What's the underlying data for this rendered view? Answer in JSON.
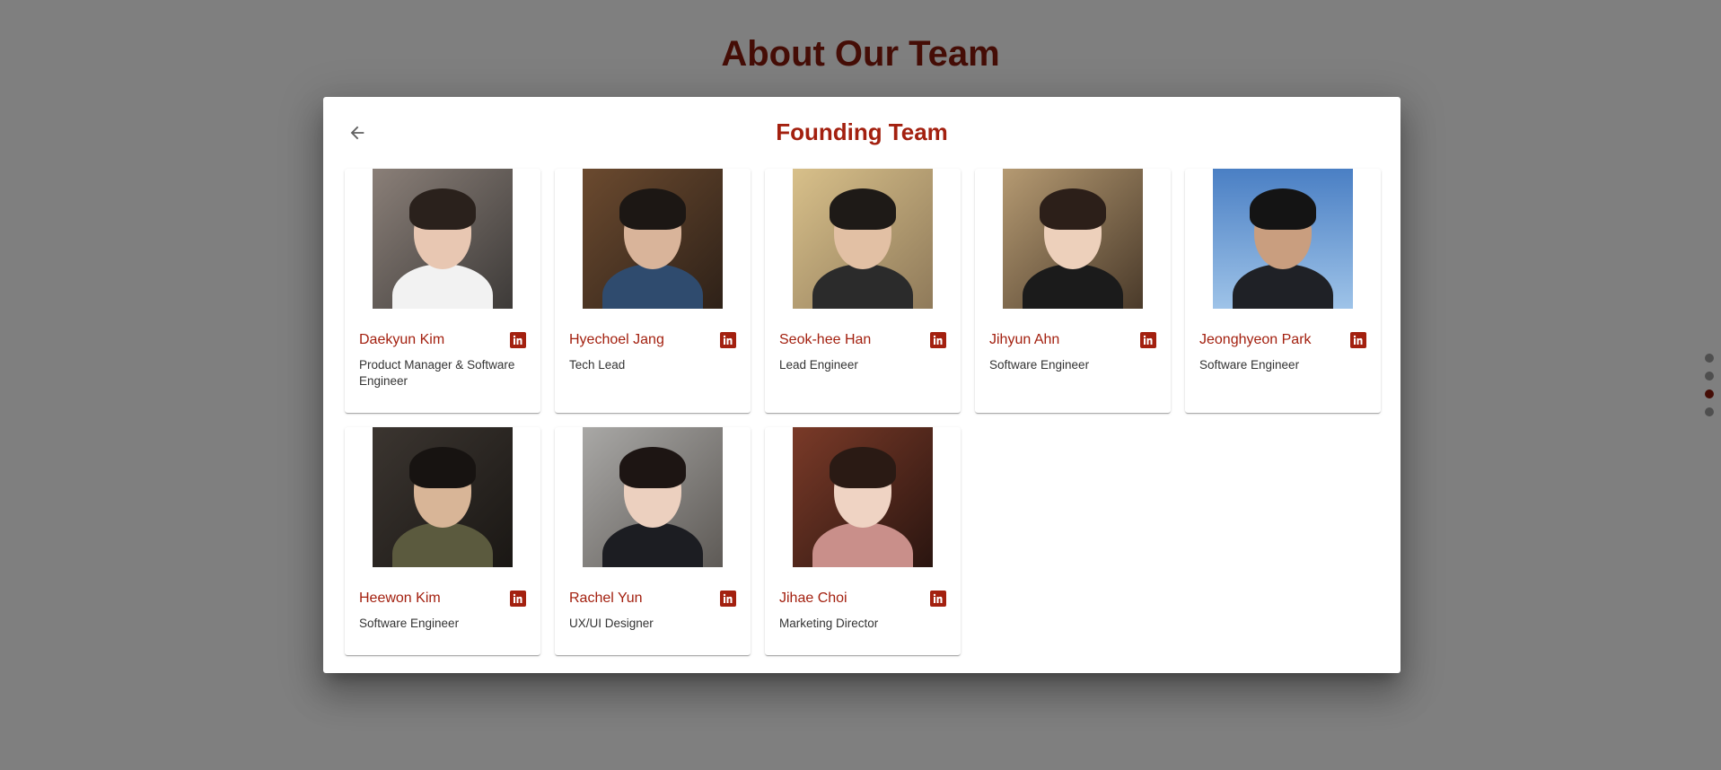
{
  "page": {
    "heading": "About Our Team"
  },
  "dialog": {
    "title": "Founding Team",
    "back_icon": "arrow-left-icon"
  },
  "colors": {
    "accent": "#a3200f",
    "heading": "#8b1a0c",
    "backdrop": "rgba(0,0,0,0.5)"
  },
  "pagination": {
    "count": 4,
    "active_index": 2
  },
  "members": [
    {
      "name": "Daekyun Kim",
      "role": "Product Manager & Software Engineer",
      "social_icon": "linkedin-icon"
    },
    {
      "name": "Hyechoel Jang",
      "role": "Tech Lead",
      "social_icon": "linkedin-icon"
    },
    {
      "name": "Seok-hee Han",
      "role": "Lead Engineer",
      "social_icon": "linkedin-icon"
    },
    {
      "name": "Jihyun Ahn",
      "role": "Software Engineer",
      "social_icon": "linkedin-icon"
    },
    {
      "name": "Jeonghyeon Park",
      "role": "Software Engineer",
      "social_icon": "linkedin-icon"
    },
    {
      "name": "Heewon Kim",
      "role": "Software Engineer",
      "social_icon": "linkedin-icon"
    },
    {
      "name": "Rachel Yun",
      "role": "UX/UI Designer",
      "social_icon": "linkedin-icon"
    },
    {
      "name": "Jihae Choi",
      "role": "Marketing Director",
      "social_icon": "linkedin-icon"
    }
  ]
}
